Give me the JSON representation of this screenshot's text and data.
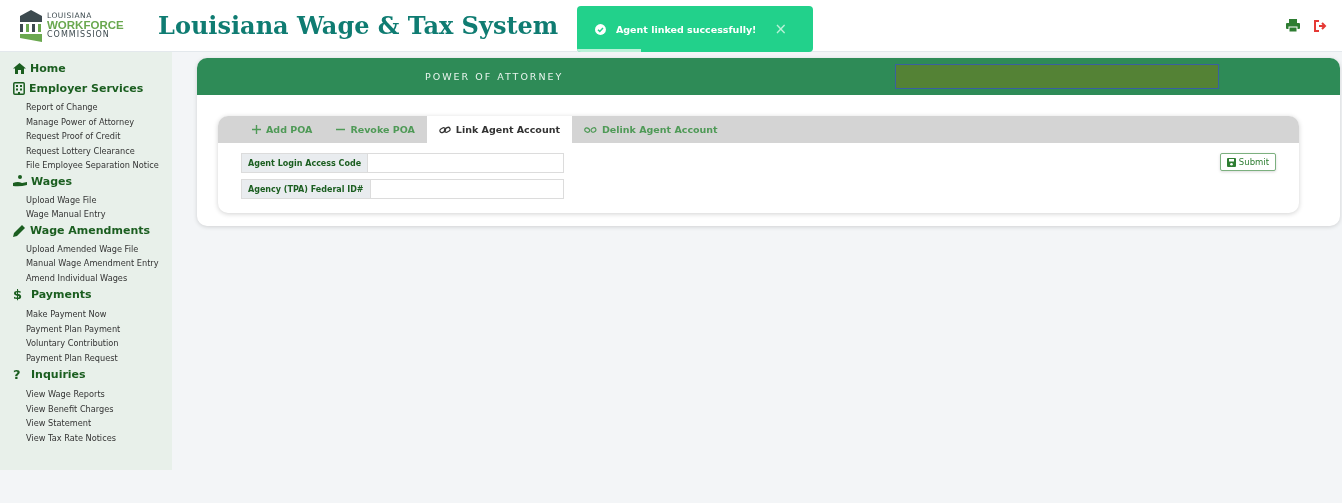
{
  "logo": {
    "top": "LOUISIANA",
    "middle": "WORKFORCE",
    "bottom": "COMMISSION"
  },
  "title": "Louisiana Wage & Tax System",
  "toast": {
    "message": "Agent linked successfully!",
    "close": "×",
    "level": 0.27
  },
  "sidebar": [
    {
      "kind": "home",
      "label": "Home"
    },
    {
      "kind": "building",
      "label": "Employer Services",
      "children": [
        "Report of Change",
        "Manage Power of Attorney",
        "Request Proof of Credit",
        "Request Lottery Clearance",
        "File Employee Separation Notice"
      ]
    },
    {
      "kind": "hand",
      "label": "Wages",
      "children": [
        "Upload Wage File",
        "Wage Manual Entry"
      ]
    },
    {
      "kind": "pencil",
      "label": "Wage Amendments",
      "children": [
        "Upload Amended Wage File",
        "Manual Wage Amendment Entry",
        "Amend Individual Wages"
      ]
    },
    {
      "kind": "glyph",
      "glyph": "$",
      "label": "Payments",
      "children": [
        "Make Payment Now",
        "Payment Plan Payment",
        "Voluntary Contribution",
        "Payment Plan Request"
      ]
    },
    {
      "kind": "glyph",
      "glyph": "?",
      "label": "Inquiries",
      "children": [
        "View Wage Reports",
        "View Benefit Charges",
        "View Statement",
        "View Tax Rate Notices"
      ]
    }
  ],
  "banner": "POWER OF ATTORNEY",
  "tabs": [
    {
      "kind": "plus",
      "label": "Add POA",
      "selected": false
    },
    {
      "kind": "minus",
      "label": "Revoke POA",
      "selected": false
    },
    {
      "kind": "link",
      "label": "Link Agent Account",
      "selected": true
    },
    {
      "kind": "unlink",
      "label": "Delink Agent Account",
      "selected": false
    }
  ],
  "fields": [
    {
      "label": "Agent Login Access Code"
    },
    {
      "label": "Agency (TPA) Federal ID#"
    }
  ],
  "submit": "Submit"
}
